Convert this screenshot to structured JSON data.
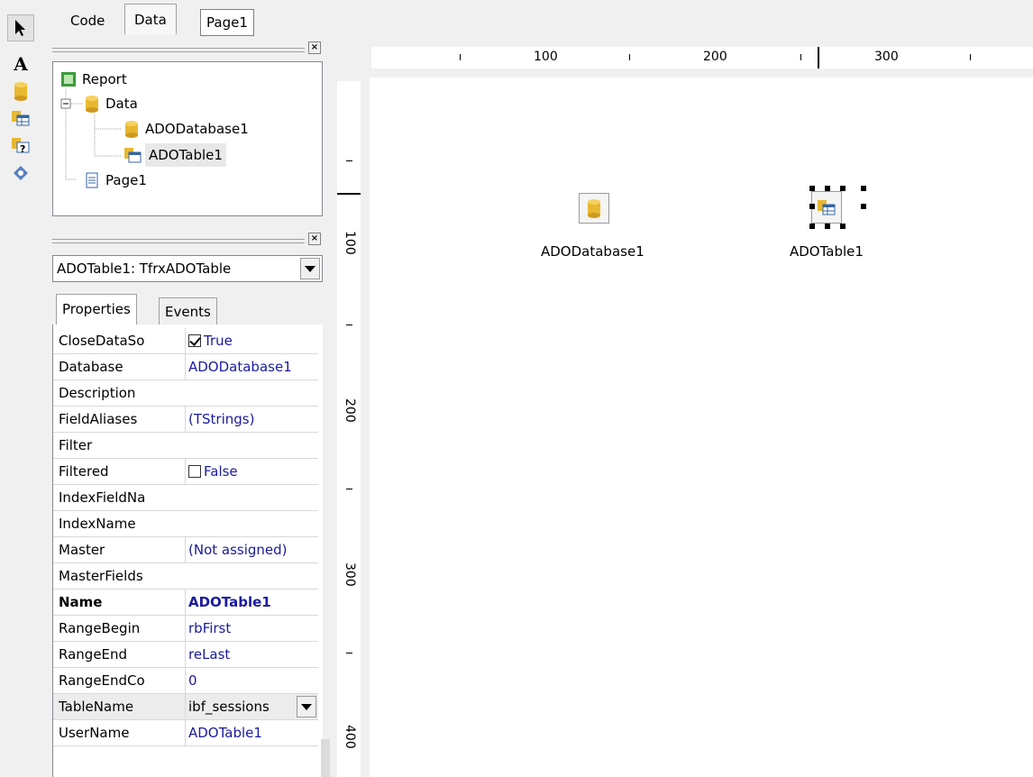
{
  "tabs": [
    {
      "label": "Code"
    },
    {
      "label": "Data"
    },
    {
      "label": "Page1"
    }
  ],
  "tools": [
    "pointer-icon",
    "text-icon",
    "database-icon",
    "table-icon",
    "query-icon",
    "wizard-icon"
  ],
  "tree": {
    "root": "Report",
    "data": "Data",
    "db": "ADODatabase1",
    "table": "ADOTable1",
    "page": "Page1"
  },
  "object_selector": {
    "value": "ADOTable1: TfrxADOTable"
  },
  "inspector_tabs": {
    "properties": "Properties",
    "events": "Events"
  },
  "properties": [
    {
      "name": "CloseDataSo",
      "value": "True",
      "checkbox": true,
      "checked": true
    },
    {
      "name": "Database",
      "value": "ADODatabase1"
    },
    {
      "name": "Description",
      "value": ""
    },
    {
      "name": "FieldAliases",
      "value": "(TStrings)"
    },
    {
      "name": "Filter",
      "value": ""
    },
    {
      "name": "Filtered",
      "value": "False",
      "checkbox": true,
      "checked": false
    },
    {
      "name": "IndexFieldNa",
      "value": ""
    },
    {
      "name": "IndexName",
      "value": ""
    },
    {
      "name": "Master",
      "value": "(Not assigned)"
    },
    {
      "name": "MasterFields",
      "value": ""
    },
    {
      "name": "Name",
      "value": "ADOTable1",
      "bold": true
    },
    {
      "name": "RangeBegin",
      "value": "rbFirst"
    },
    {
      "name": "RangeEnd",
      "value": "reLast"
    },
    {
      "name": "RangeEndCo",
      "value": "0"
    },
    {
      "name": "TableName",
      "value": "ibf_sessions",
      "dropdown": true
    },
    {
      "name": "UserName",
      "value": "ADOTable1"
    }
  ],
  "ruler": {
    "h": [
      "100",
      "200",
      "300"
    ],
    "v": [
      "100",
      "200",
      "300",
      "400"
    ]
  },
  "canvas": {
    "db_label": "ADODatabase1",
    "table_label": "ADOTable1"
  },
  "colors": {
    "value_text": "#1a1aa0",
    "db_yellow": "#e8b830"
  }
}
